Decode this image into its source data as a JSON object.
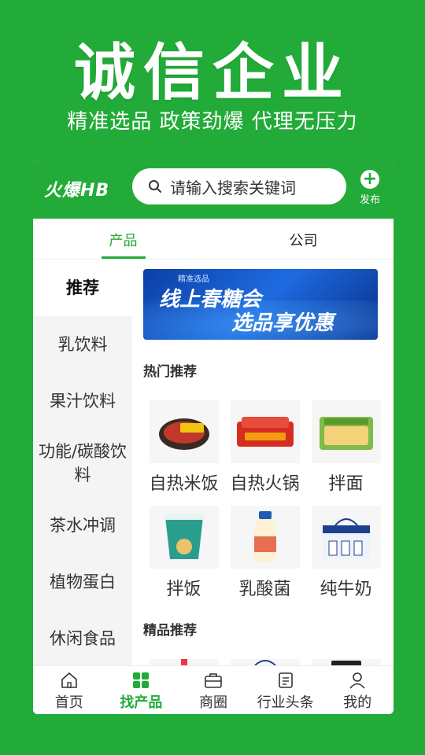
{
  "hero": {
    "title": "诚信企业",
    "subtitle": "精准选品 政策劲爆 代理无压力"
  },
  "app": {
    "logo": "火爆HB",
    "search_placeholder": "请输入搜索关键词",
    "publish_label": "发布",
    "accent_color": "#22ab38"
  },
  "tabs": [
    {
      "label": "产品",
      "active": true
    },
    {
      "label": "公司",
      "active": false
    }
  ],
  "sidebar": {
    "items": [
      {
        "label": "推荐",
        "active": true
      },
      {
        "label": "乳饮料",
        "active": false
      },
      {
        "label": "果汁饮料",
        "active": false
      },
      {
        "label": "功能/碳酸饮料",
        "active": false
      },
      {
        "label": "茶水冲调",
        "active": false
      },
      {
        "label": "植物蛋白",
        "active": false
      },
      {
        "label": "休闲食品",
        "active": false
      }
    ]
  },
  "banner": {
    "tag": "精准选品",
    "line1": "线上春糖会",
    "line2": "选品享优惠"
  },
  "hot": {
    "title": "热门推荐",
    "items": [
      {
        "label": "自热米饭",
        "icon": "self-heating-rice-icon"
      },
      {
        "label": "自热火锅",
        "icon": "self-heating-hotpot-icon"
      },
      {
        "label": "拌面",
        "icon": "mixed-noodles-icon"
      },
      {
        "label": "拌饭",
        "icon": "mixed-rice-cup-icon"
      },
      {
        "label": "乳酸菌",
        "icon": "lactobacillus-bottle-icon"
      },
      {
        "label": "纯牛奶",
        "icon": "milk-box-icon"
      }
    ]
  },
  "featured": {
    "title": "精品推荐"
  },
  "bottom_nav": [
    {
      "label": "首页",
      "icon": "home-icon",
      "active": false
    },
    {
      "label": "找产品",
      "icon": "grid-icon",
      "active": true
    },
    {
      "label": "商圈",
      "icon": "briefcase-icon",
      "active": false
    },
    {
      "label": "行业头条",
      "icon": "news-icon",
      "active": false
    },
    {
      "label": "我的",
      "icon": "user-icon",
      "active": false
    }
  ]
}
